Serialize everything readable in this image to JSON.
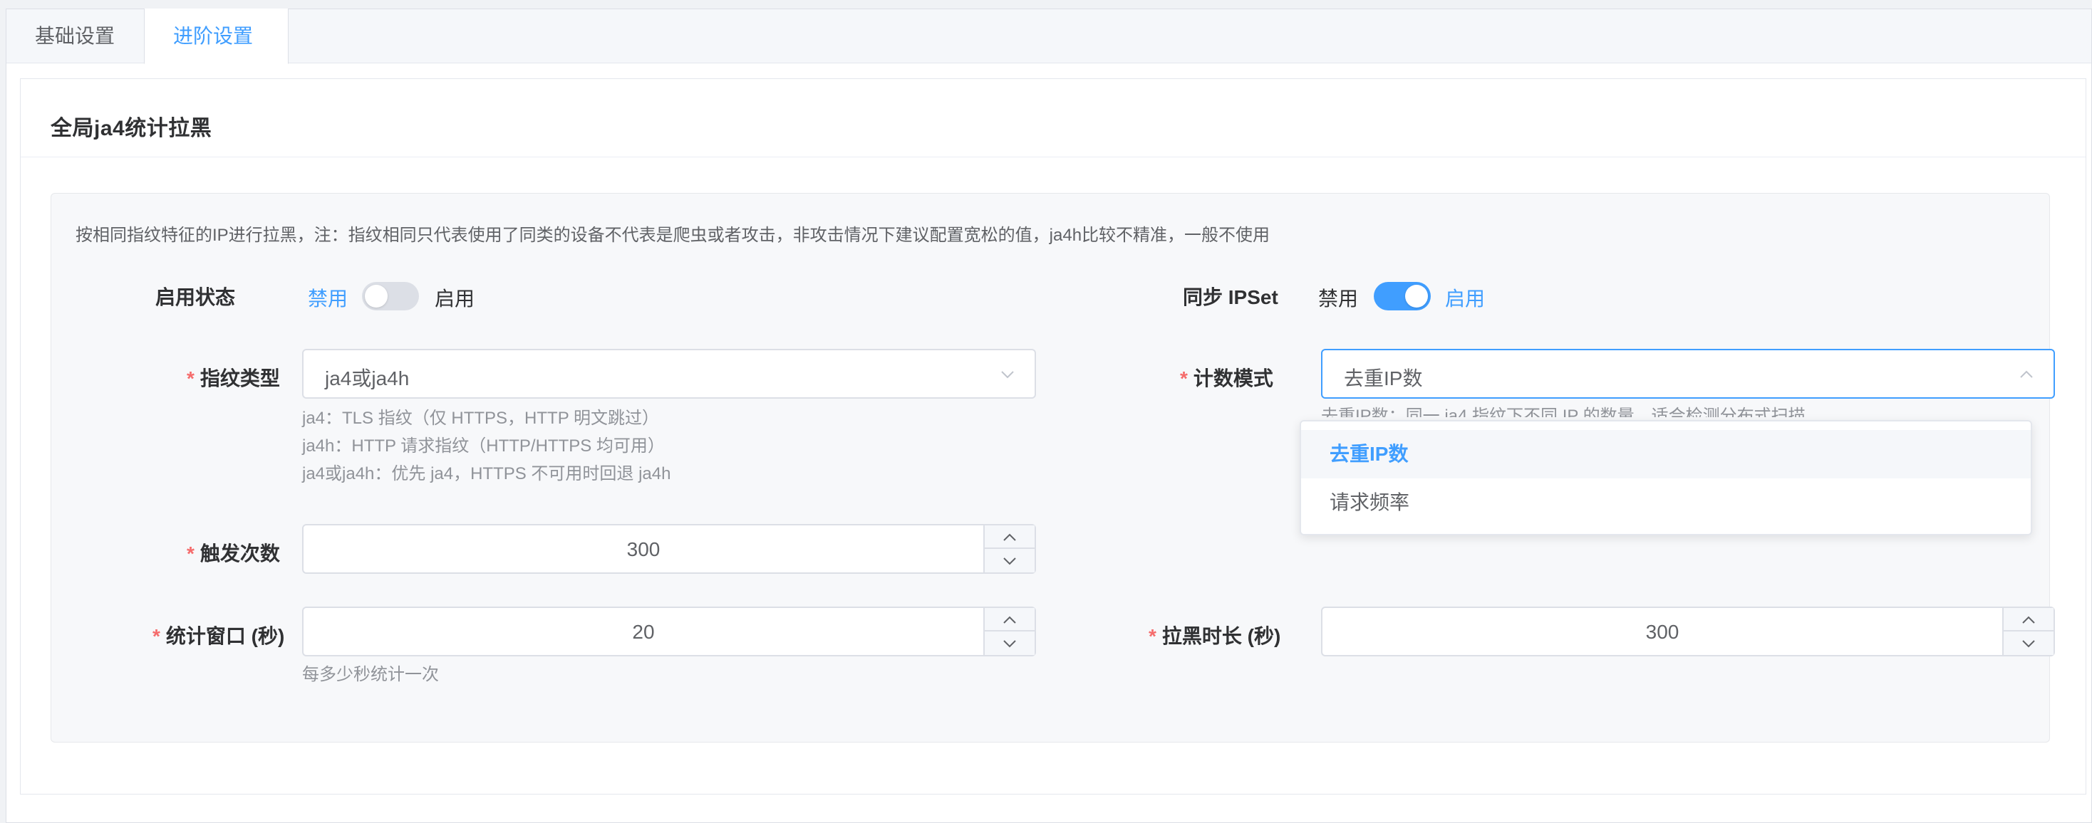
{
  "tabs": [
    {
      "label": "基础设置",
      "active": false
    },
    {
      "label": "进阶设置",
      "active": true
    }
  ],
  "card": {
    "title": "全局ja4统计拉黑",
    "description": "按相同指纹特征的IP进行拉黑，注：指纹相同只代表使用了同类的设备不代表是爬虫或者攻击，非攻击情况下建议配置宽松的值，ja4h比较不精准，一般不使用"
  },
  "enable_status": {
    "label": "启用状态",
    "off_label": "禁用",
    "on_label": "启用",
    "state": "off"
  },
  "sync_ipset": {
    "label": "同步 IPSet",
    "off_label": "禁用",
    "on_label": "启用",
    "state": "on"
  },
  "fingerprint_type": {
    "required_mark": "*",
    "label": "指纹类型",
    "value": "ja4或ja4h",
    "help": [
      "ja4：TLS 指纹（仅 HTTPS，HTTP 明文跳过）",
      "ja4h：HTTP 请求指纹（HTTP/HTTPS 均可用）",
      "ja4或ja4h：优先 ja4，HTTPS 不可用时回退 ja4h"
    ]
  },
  "count_mode": {
    "required_mark": "*",
    "label": "计数模式",
    "value": "去重IP数",
    "help_partial": "去重IP数：同一 ja4 指纹下不同 IP 的数量，适合检测分布式扫描",
    "options": [
      "去重IP数",
      "请求频率"
    ],
    "selected_option": "去重IP数"
  },
  "trigger_count": {
    "required_mark": "*",
    "label": "触发次数",
    "value": "300"
  },
  "stat_window": {
    "required_mark": "*",
    "label": "统计窗口 (秒)",
    "value": "20",
    "help": "每多少秒统计一次"
  },
  "block_duration": {
    "required_mark": "*",
    "label": "拉黑时长 (秒)",
    "value": "300"
  },
  "icons": {
    "chevron_down": "chevron-down-icon",
    "chevron_up": "chevron-up-icon",
    "step_up": "step-up-icon",
    "step_down": "step-down-icon"
  },
  "colors": {
    "accent": "#409eff",
    "required": "#f56c6c",
    "switch_off": "#dcdfe6"
  }
}
